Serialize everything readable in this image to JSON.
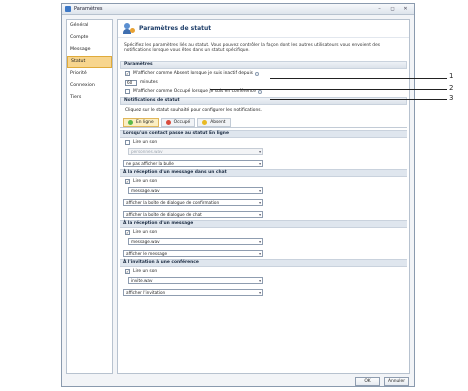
{
  "window": {
    "title": "Paramètres",
    "buttons": [
      "–",
      "◻",
      "✕"
    ]
  },
  "sidebar": {
    "items": [
      {
        "label": "Général"
      },
      {
        "label": "Compte"
      },
      {
        "label": "Message"
      },
      {
        "label": "Statut"
      },
      {
        "label": "Priorité"
      },
      {
        "label": "Connexion"
      },
      {
        "label": "Tiers"
      }
    ],
    "active": "Statut"
  },
  "header": {
    "title": "Paramètres de statut"
  },
  "description": "Spécifiez les paramètres liés au statut. Vous pouvez contrôler la façon dont les autres utilisateurs vous envoient des notifications lorsque vous êtes dans un statut spécifique.",
  "parametres": {
    "label": "Paramètres",
    "away_label": "M'afficher comme Absent lorsque je suis inactif depuis",
    "minutes_value": "60",
    "minutes_unit": "minutes",
    "busy_label": "M'afficher comme Occupé lorsque je suis en conférence"
  },
  "notifications": {
    "label": "Notifications de statut",
    "hint": "Cliquez sur le statut souhaité pour configurer les notifications.",
    "tabs": [
      {
        "label": "En ligne",
        "color": "#5ab94a"
      },
      {
        "label": "Occupé",
        "color": "#d94b3c"
      },
      {
        "label": "Absent",
        "color": "#e8b923"
      }
    ]
  },
  "groups": {
    "contact": {
      "title": "Lorsqu'un contact passe au statut En ligne",
      "checkbox_label": "Lire un son",
      "combo1": "personnes.wav",
      "combo2": "ne pas afficher la bulle"
    },
    "chat": {
      "title": "À la réception d'un message dans un chat",
      "checkbox_label": "Lire un son",
      "combo1": "message.wav",
      "combo2": "afficher la boîte de dialogue de confirmation",
      "combo3": "afficher la boîte de dialogue de chat"
    },
    "message": {
      "title": "À la réception d'un message",
      "checkbox_label": "Lire un son",
      "combo1": "message.wav",
      "combo2": "afficher le message"
    },
    "conference": {
      "title": "À l'invitation à une conférence",
      "checkbox_label": "Lire un son",
      "combo1": "invite.wav",
      "combo2": "afficher l'invitation"
    }
  },
  "footer": {
    "ok": "OK",
    "cancel": "Annuler"
  },
  "callouts": [
    "1",
    "2",
    "3"
  ]
}
